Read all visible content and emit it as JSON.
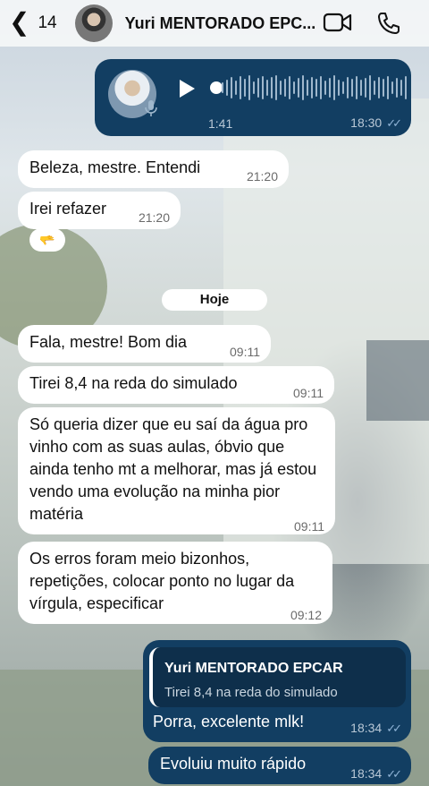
{
  "header": {
    "back_count": "14",
    "contact_name": "Yuri MENTORADO EPC...",
    "icons": [
      "chevron-left-icon",
      "video-call-icon",
      "phone-icon"
    ]
  },
  "audio_message": {
    "duration": "1:41",
    "time": "18:30",
    "playback_progress": 0
  },
  "messages_old": [
    {
      "text": "Beleza, mestre. Entendi",
      "time": "21:20"
    },
    {
      "text": "Irei refazer",
      "time": "21:20"
    }
  ],
  "reaction": "🫳",
  "day_separator": "Hoje",
  "messages_today": [
    {
      "text": "Fala, mestre! Bom dia",
      "time": "09:11"
    },
    {
      "text": "Tirei 8,4 na reda do simulado",
      "time": "09:11"
    },
    {
      "text": "Só queria dizer que eu saí da água pro vinho com as suas aulas, óbvio que ainda tenho mt a melhorar, mas já estou vendo uma evolução na minha pior matéria",
      "time": "09:11"
    },
    {
      "text": "Os erros foram meio bizonhos, repetições, colocar ponto no lugar da vírgula, especificar",
      "time": "09:12"
    }
  ],
  "reply_message": {
    "quoted_name": "Yuri MENTORADO EPCAR",
    "quoted_text": "Tirei 8,4 na reda do simulado",
    "text": "Porra, excelente mlk!",
    "time": "18:34"
  },
  "last_message": {
    "text": "Evoluiu muito rápido",
    "time": "18:34"
  },
  "colors": {
    "outgoing_bubble": "#123e62",
    "incoming_bubble": "#ffffff",
    "read_ticks": "#8fb3d6"
  }
}
